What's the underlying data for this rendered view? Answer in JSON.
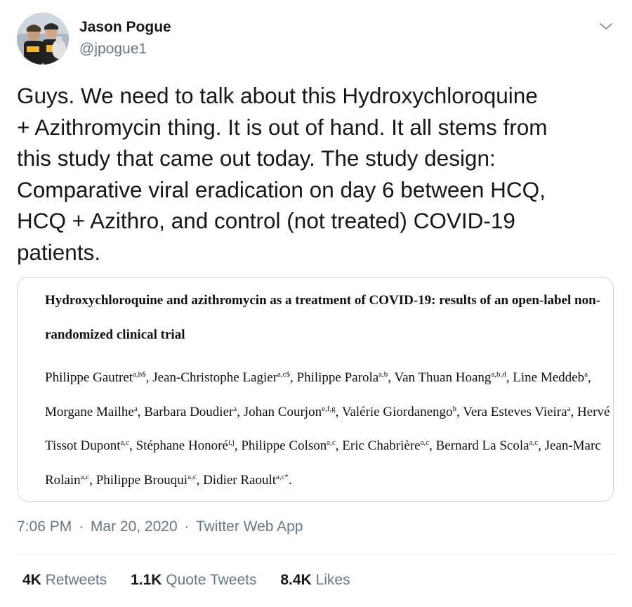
{
  "author": {
    "display_name": "Jason Pogue",
    "handle": "@jpogue1"
  },
  "tweet": {
    "text": "Guys. We need to talk about this Hydroxychloroquine\n+ Azithromycin thing. It is out of hand. It all stems from\nthis study that came out today. The study design:\nComparative viral eradication on day 6 between HCQ,\nHCQ + Azithro, and control (not treated) COVID-19\npatients."
  },
  "media": {
    "paper_title": "Hydroxychloroquine and azithromycin as a treatment of COVID-19: results of an open-label non-randomized clinical trial",
    "authors": [
      {
        "name": "Philippe Gautret",
        "sup": "a,b$"
      },
      {
        "name": "Jean-Christophe Lagier",
        "sup": "a,c$"
      },
      {
        "name": "Philippe Parola",
        "sup": "a,b"
      },
      {
        "name": "Van Thuan Hoang",
        "sup": "a,b,d"
      },
      {
        "name": "Line Meddeb",
        "sup": "a"
      },
      {
        "name": "Morgane Mailhe",
        "sup": "a"
      },
      {
        "name": "Barbara Doudier",
        "sup": "a"
      },
      {
        "name": "Johan Courjon",
        "sup": "e,f,g"
      },
      {
        "name": "Valérie Giordanengo",
        "sup": "h"
      },
      {
        "name": "Vera Esteves Vieira",
        "sup": "a"
      },
      {
        "name": "Hervé Tissot Dupont",
        "sup": "a,c"
      },
      {
        "name": "Stéphane Honoré",
        "sup": "i,j"
      },
      {
        "name": "Philippe Colson",
        "sup": "a,c"
      },
      {
        "name": "Eric Chabrière",
        "sup": "a,c"
      },
      {
        "name": "Bernard La Scola",
        "sup": "a,c"
      },
      {
        "name": "Jean-Marc Rolain",
        "sup": "a,c"
      },
      {
        "name": "Philippe Brouqui",
        "sup": "a,c"
      },
      {
        "name": "Didier Raoult",
        "sup": "a,c*"
      }
    ]
  },
  "meta": {
    "time": "7:06 PM",
    "separator": "·",
    "date": "Mar 20, 2020",
    "source": "Twitter Web App"
  },
  "stats": {
    "retweets_count": "4K",
    "retweets_label": "Retweets",
    "quote_count": "1.1K",
    "quote_label": "Quote Tweets",
    "likes_count": "8.4K",
    "likes_label": "Likes"
  },
  "icons": {
    "avatar": "profile-photo",
    "caret": "chevron-down-icon"
  },
  "colors": {
    "text_primary": "#14171a",
    "text_secondary": "#657786",
    "border": "#ccd6dd"
  }
}
